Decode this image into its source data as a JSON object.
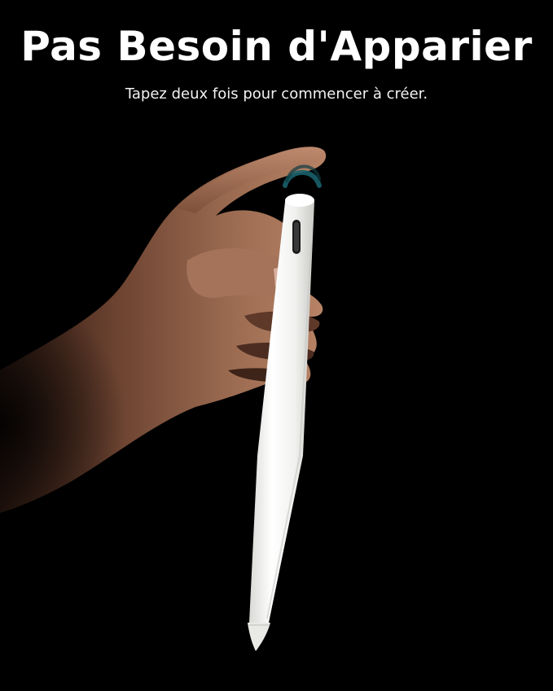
{
  "banner": {
    "headline": "Pas Besoin d'Apparier",
    "subheadline": "Tapez deux fois pour commencer à créer."
  },
  "product": {
    "name_icon": "stylus-pen",
    "pen_color": "#f4f4f2",
    "tap_indicator_color": "#18606a",
    "background_color": "#000000"
  }
}
